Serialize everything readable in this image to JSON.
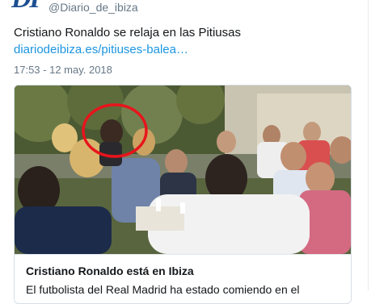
{
  "header": {
    "avatar_text": "DI",
    "handle": "@Diario_de_ibiza"
  },
  "tweet": {
    "text": "Cristiano Ronaldo se relaja en las Pitiusas",
    "link": "diariodeibiza.es/pitiuses-balea…",
    "timestamp": "17:53 - 12 may. 2018"
  },
  "card": {
    "title": "Cristiano Ronaldo está en Ibiza",
    "description": "El futbolista del Real Madrid ha estado comiendo en el",
    "highlight_color": "#e8141c"
  }
}
